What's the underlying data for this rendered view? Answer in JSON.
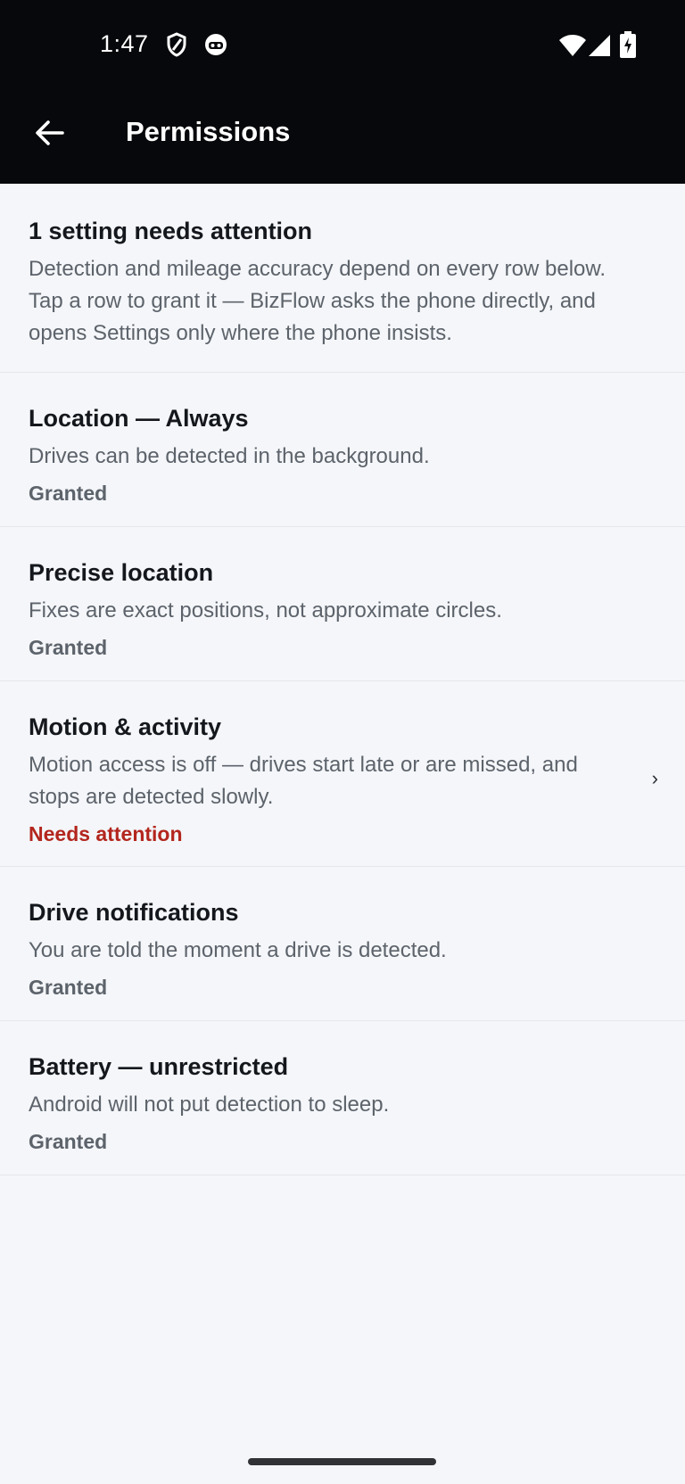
{
  "status_bar": {
    "time": "1:47",
    "icons": [
      "shield-icon",
      "robot-icon",
      "wifi-icon",
      "signal-icon",
      "battery-charging-icon"
    ]
  },
  "app_bar": {
    "back_icon": "arrow-back-icon",
    "title": "Permissions"
  },
  "summary": {
    "title": "1 setting needs attention",
    "description": "Detection and mileage accuracy depend on every row below. Tap a row to grant it — BizFlow asks the phone directly, and opens Settings only where the phone insists."
  },
  "permissions": [
    {
      "title": "Location — Always",
      "description": "Drives can be detected in the background.",
      "status": "Granted"
    },
    {
      "title": "Precise location",
      "description": "Fixes are exact positions, not approximate circles.",
      "status": "Granted"
    },
    {
      "title": "Motion & activity",
      "description": "Motion access is off — drives start late or are missed, and stops are detected slowly.",
      "status": "Needs attention",
      "chevron": "›"
    },
    {
      "title": "Drive notifications",
      "description": "You are told the moment a drive is detected.",
      "status": "Granted"
    },
    {
      "title": "Battery — unrestricted",
      "description": "Android will not put detection to sleep.",
      "status": "Granted"
    }
  ],
  "colors": {
    "header_bg": "#07080b",
    "page_bg": "#f4f6f9",
    "attention": "#b3261e",
    "granted": "#5d636b"
  }
}
